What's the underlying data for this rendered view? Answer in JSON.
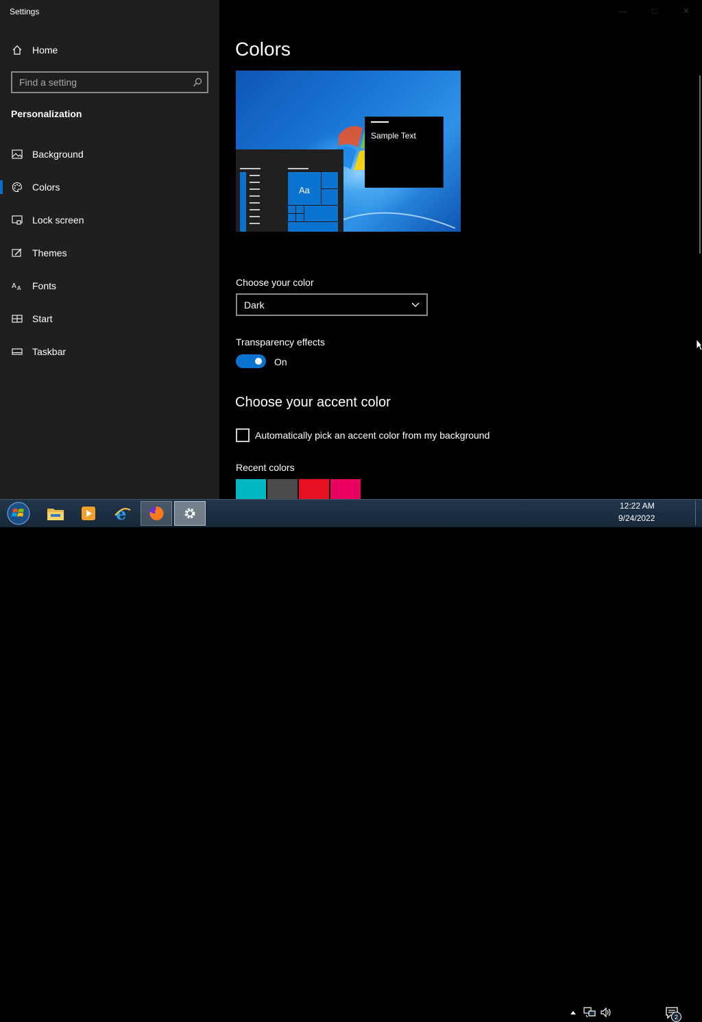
{
  "window": {
    "title": "Settings"
  },
  "sidebar": {
    "home_label": "Home",
    "search_placeholder": "Find a setting",
    "section": "Personalization",
    "items": [
      {
        "label": "Background",
        "icon": "picture-icon"
      },
      {
        "label": "Colors",
        "icon": "palette-icon",
        "active": true
      },
      {
        "label": "Lock screen",
        "icon": "lock-screen-icon"
      },
      {
        "label": "Themes",
        "icon": "themes-icon"
      },
      {
        "label": "Fonts",
        "icon": "fonts-icon"
      },
      {
        "label": "Start",
        "icon": "start-icon"
      },
      {
        "label": "Taskbar",
        "icon": "taskbar-icon"
      }
    ]
  },
  "main": {
    "title": "Colors",
    "preview": {
      "sample_text": "Sample Text",
      "tile_text": "Aa"
    },
    "choose_color": {
      "label": "Choose your color",
      "value": "Dark"
    },
    "transparency": {
      "label": "Transparency effects",
      "state": "On",
      "enabled": true
    },
    "accent": {
      "heading": "Choose your accent color",
      "auto_label": "Automatically pick an accent color from my background",
      "auto_checked": false,
      "recent_label": "Recent colors",
      "recent_colors": [
        "#00b7c3",
        "#4c4a48",
        "#e81123",
        "#ea005e"
      ]
    }
  },
  "colors": {
    "accent": "#0a73d0",
    "sidebar_bg": "#1f1f1f",
    "main_bg": "#000000"
  },
  "taskbar": {
    "apps": [
      "start-orb-icon",
      "file-explorer-icon",
      "media-player-icon",
      "internet-explorer-icon",
      "firefox-icon",
      "settings-gear-icon"
    ],
    "time": "12:22 AM",
    "date": "9/24/2022",
    "notification_count": "2"
  }
}
